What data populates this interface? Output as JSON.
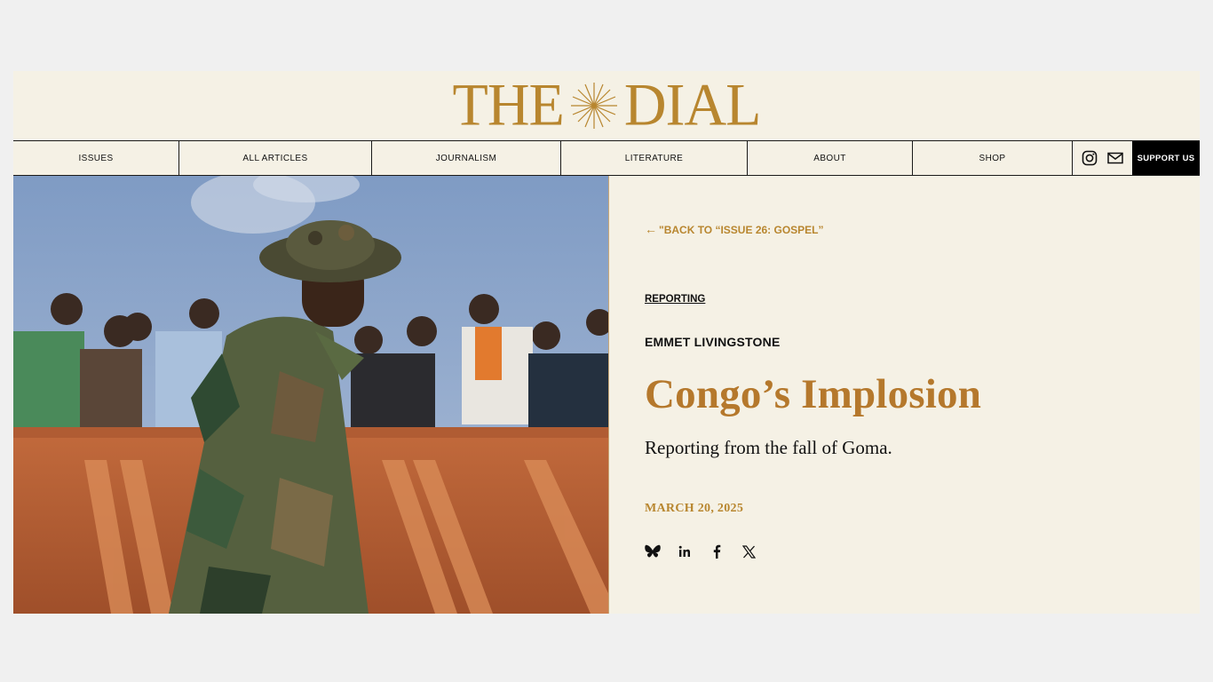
{
  "brand": {
    "logo_left": "THE",
    "logo_right": "DIAL",
    "color": "#b8862f"
  },
  "nav": {
    "items": [
      {
        "label": "ISSUES"
      },
      {
        "label": "ALL ARTICLES"
      },
      {
        "label": "JOURNALISM"
      },
      {
        "label": "LITERATURE"
      },
      {
        "label": "ABOUT"
      },
      {
        "label": "SHOP"
      }
    ],
    "icons": [
      "instagram-icon",
      "mail-icon"
    ],
    "support_label": "SUPPORT US"
  },
  "hero": {
    "image_icon": "photo-soldier-crowd-truck"
  },
  "article": {
    "back_link": "\"BACK TO “ISSUE 26: GOSPEL”",
    "category": "REPORTING",
    "author": "EMMET LIVINGSTONE",
    "title": "Congo’s Implosion",
    "dek": "Reporting from the fall of Goma.",
    "date": "MARCH 20, 2025",
    "share_icons": [
      "bluesky-icon",
      "linkedin-icon",
      "facebook-icon",
      "x-icon"
    ],
    "title_color": "#b5782c"
  }
}
